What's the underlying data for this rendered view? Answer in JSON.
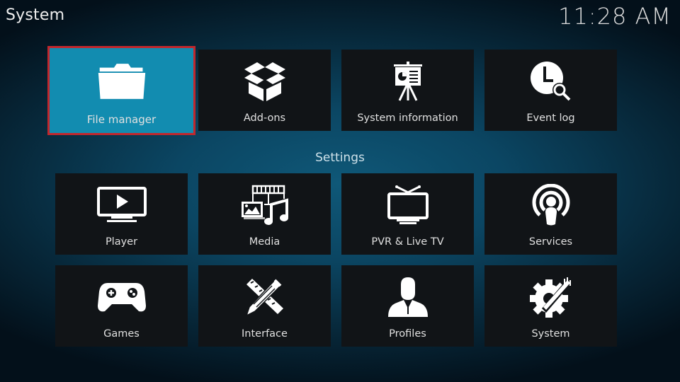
{
  "header": {
    "title": "System",
    "clock": "11:28 AM"
  },
  "top_row": [
    {
      "id": "file-manager",
      "label": "File manager",
      "icon": "folder-icon",
      "focused": true
    },
    {
      "id": "add-ons",
      "label": "Add-ons",
      "icon": "box-icon",
      "focused": false
    },
    {
      "id": "system-information",
      "label": "System information",
      "icon": "presentation-board-icon",
      "focused": false
    },
    {
      "id": "event-log",
      "label": "Event log",
      "icon": "clock-search-icon",
      "focused": false
    }
  ],
  "settings": {
    "heading": "Settings",
    "items": [
      {
        "id": "player",
        "label": "Player",
        "icon": "tv-play-icon"
      },
      {
        "id": "media",
        "label": "Media",
        "icon": "media-icon"
      },
      {
        "id": "pvr-live-tv",
        "label": "PVR & Live TV",
        "icon": "antenna-tv-icon"
      },
      {
        "id": "services",
        "label": "Services",
        "icon": "broadcast-icon"
      },
      {
        "id": "games",
        "label": "Games",
        "icon": "gamepad-icon"
      },
      {
        "id": "interface",
        "label": "Interface",
        "icon": "pencil-ruler-icon"
      },
      {
        "id": "profiles",
        "label": "Profiles",
        "icon": "user-icon"
      },
      {
        "id": "system",
        "label": "System",
        "icon": "gear-wrench-icon"
      }
    ]
  },
  "colors": {
    "focus_fill": "#128cb0",
    "focus_border": "#c1272d",
    "tile_bg": "#111417"
  }
}
